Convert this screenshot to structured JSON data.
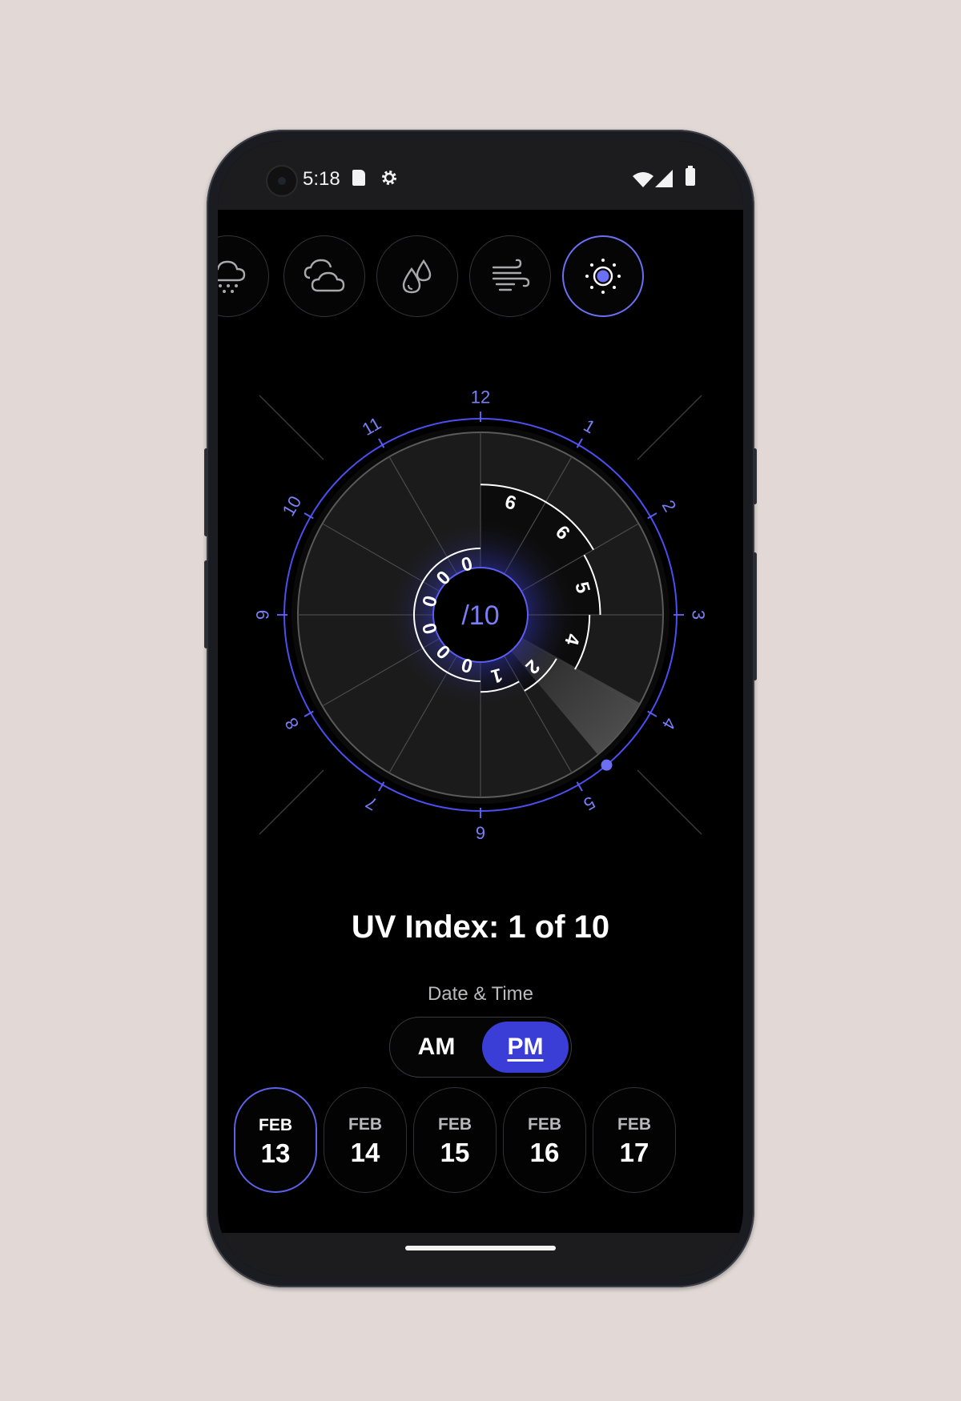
{
  "status_bar": {
    "time": "5:18",
    "icons": [
      "camera-icon",
      "sd-card-icon",
      "settings-gear-icon",
      "wifi-icon",
      "signal-icon",
      "battery-icon"
    ]
  },
  "categories": [
    {
      "name": "snow-cloud-icon",
      "active": false
    },
    {
      "name": "partly-cloudy-icon",
      "active": false
    },
    {
      "name": "humidity-drops-icon",
      "active": false
    },
    {
      "name": "wind-icon",
      "active": false
    },
    {
      "name": "uv-sun-icon",
      "active": true
    }
  ],
  "dial": {
    "center_label": "/10",
    "hour_labels": [
      "12",
      "1",
      "2",
      "3",
      "4",
      "5",
      "6",
      "7",
      "8",
      "9",
      "10",
      "11"
    ],
    "uv_values": [
      "6",
      "6",
      "5",
      "4",
      "2",
      "1",
      "0",
      "0",
      "0",
      "0",
      "0",
      "0"
    ],
    "selected_hour": "5"
  },
  "uv_title": "UV Index: 1 of 10",
  "date_time_label": "Date & Time",
  "am_label": "AM",
  "pm_label": "PM",
  "selected_period": "PM",
  "dates": [
    {
      "month": "FEB",
      "day": "13",
      "active": true
    },
    {
      "month": "FEB",
      "day": "14",
      "active": false
    },
    {
      "month": "FEB",
      "day": "15",
      "active": false
    },
    {
      "month": "FEB",
      "day": "16",
      "active": false
    },
    {
      "month": "FEB",
      "day": "17",
      "active": false
    }
  ],
  "colors": {
    "accent": "#6b6ff4",
    "pm_fill": "#3a3ed6",
    "background": "#e2d9d6",
    "screen": "#000000"
  }
}
